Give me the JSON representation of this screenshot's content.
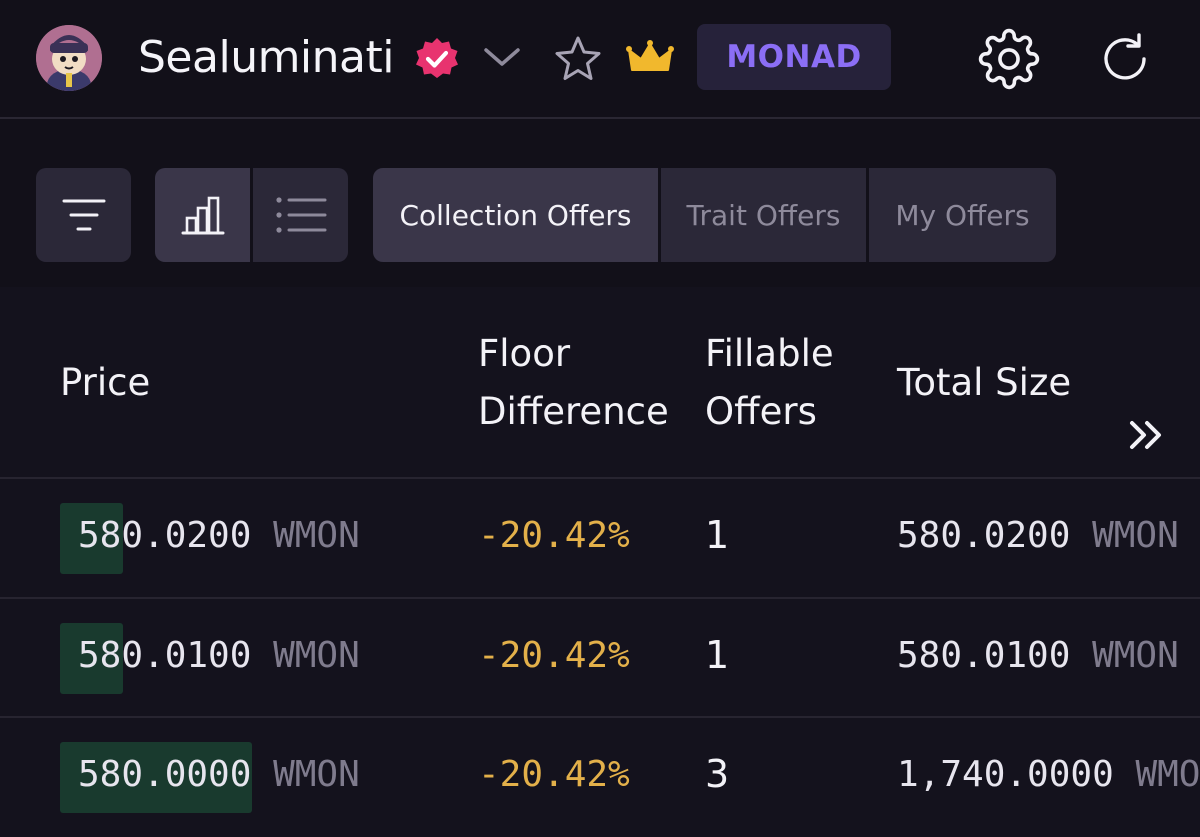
{
  "header": {
    "collection_name": "Sealuminati",
    "chain_badge": "MONAD"
  },
  "toolbar": {
    "tabs": [
      {
        "label": "Collection Offers",
        "active": true
      },
      {
        "label": "Trait Offers",
        "active": false
      },
      {
        "label": "My Offers",
        "active": false
      }
    ]
  },
  "table": {
    "columns": {
      "price": "Price",
      "floor_line1": "Floor",
      "floor_line2": "Difference",
      "fillable_line1": "Fillable",
      "fillable_line2": "Offers",
      "total": "Total Size"
    },
    "rows": [
      {
        "price": "580.0200",
        "unit": "WMON",
        "floor_diff": "-20.42%",
        "fillable": "1",
        "total": "580.0200",
        "total_unit": "WMON",
        "depth_fraction": 0.33
      },
      {
        "price": "580.0100",
        "unit": "WMON",
        "floor_diff": "-20.42%",
        "fillable": "1",
        "total": "580.0100",
        "total_unit": "WMON",
        "depth_fraction": 0.33
      },
      {
        "price": "580.0000",
        "unit": "WMON",
        "floor_diff": "-20.42%",
        "fillable": "3",
        "total": "1,740.0000",
        "total_unit": "WMON",
        "depth_fraction": 1.0
      }
    ]
  },
  "colors": {
    "background": "#121019",
    "accent_purple": "#8b6ef5",
    "verified_pink": "#e8336f",
    "crown_gold": "#f1b82d",
    "floor_diff": "#e3b04a",
    "depth_bar": "#193a2e"
  },
  "icons": {
    "verified": "verified-badge-icon",
    "chevron": "chevron-down-icon",
    "favorite": "star-outline-icon",
    "crown": "crown-icon",
    "settings": "gear-icon",
    "refresh": "refresh-icon",
    "filter": "filter-icon",
    "chart_view": "bar-chart-icon",
    "list_view": "list-icon",
    "more_columns": "double-chevron-right-icon"
  }
}
